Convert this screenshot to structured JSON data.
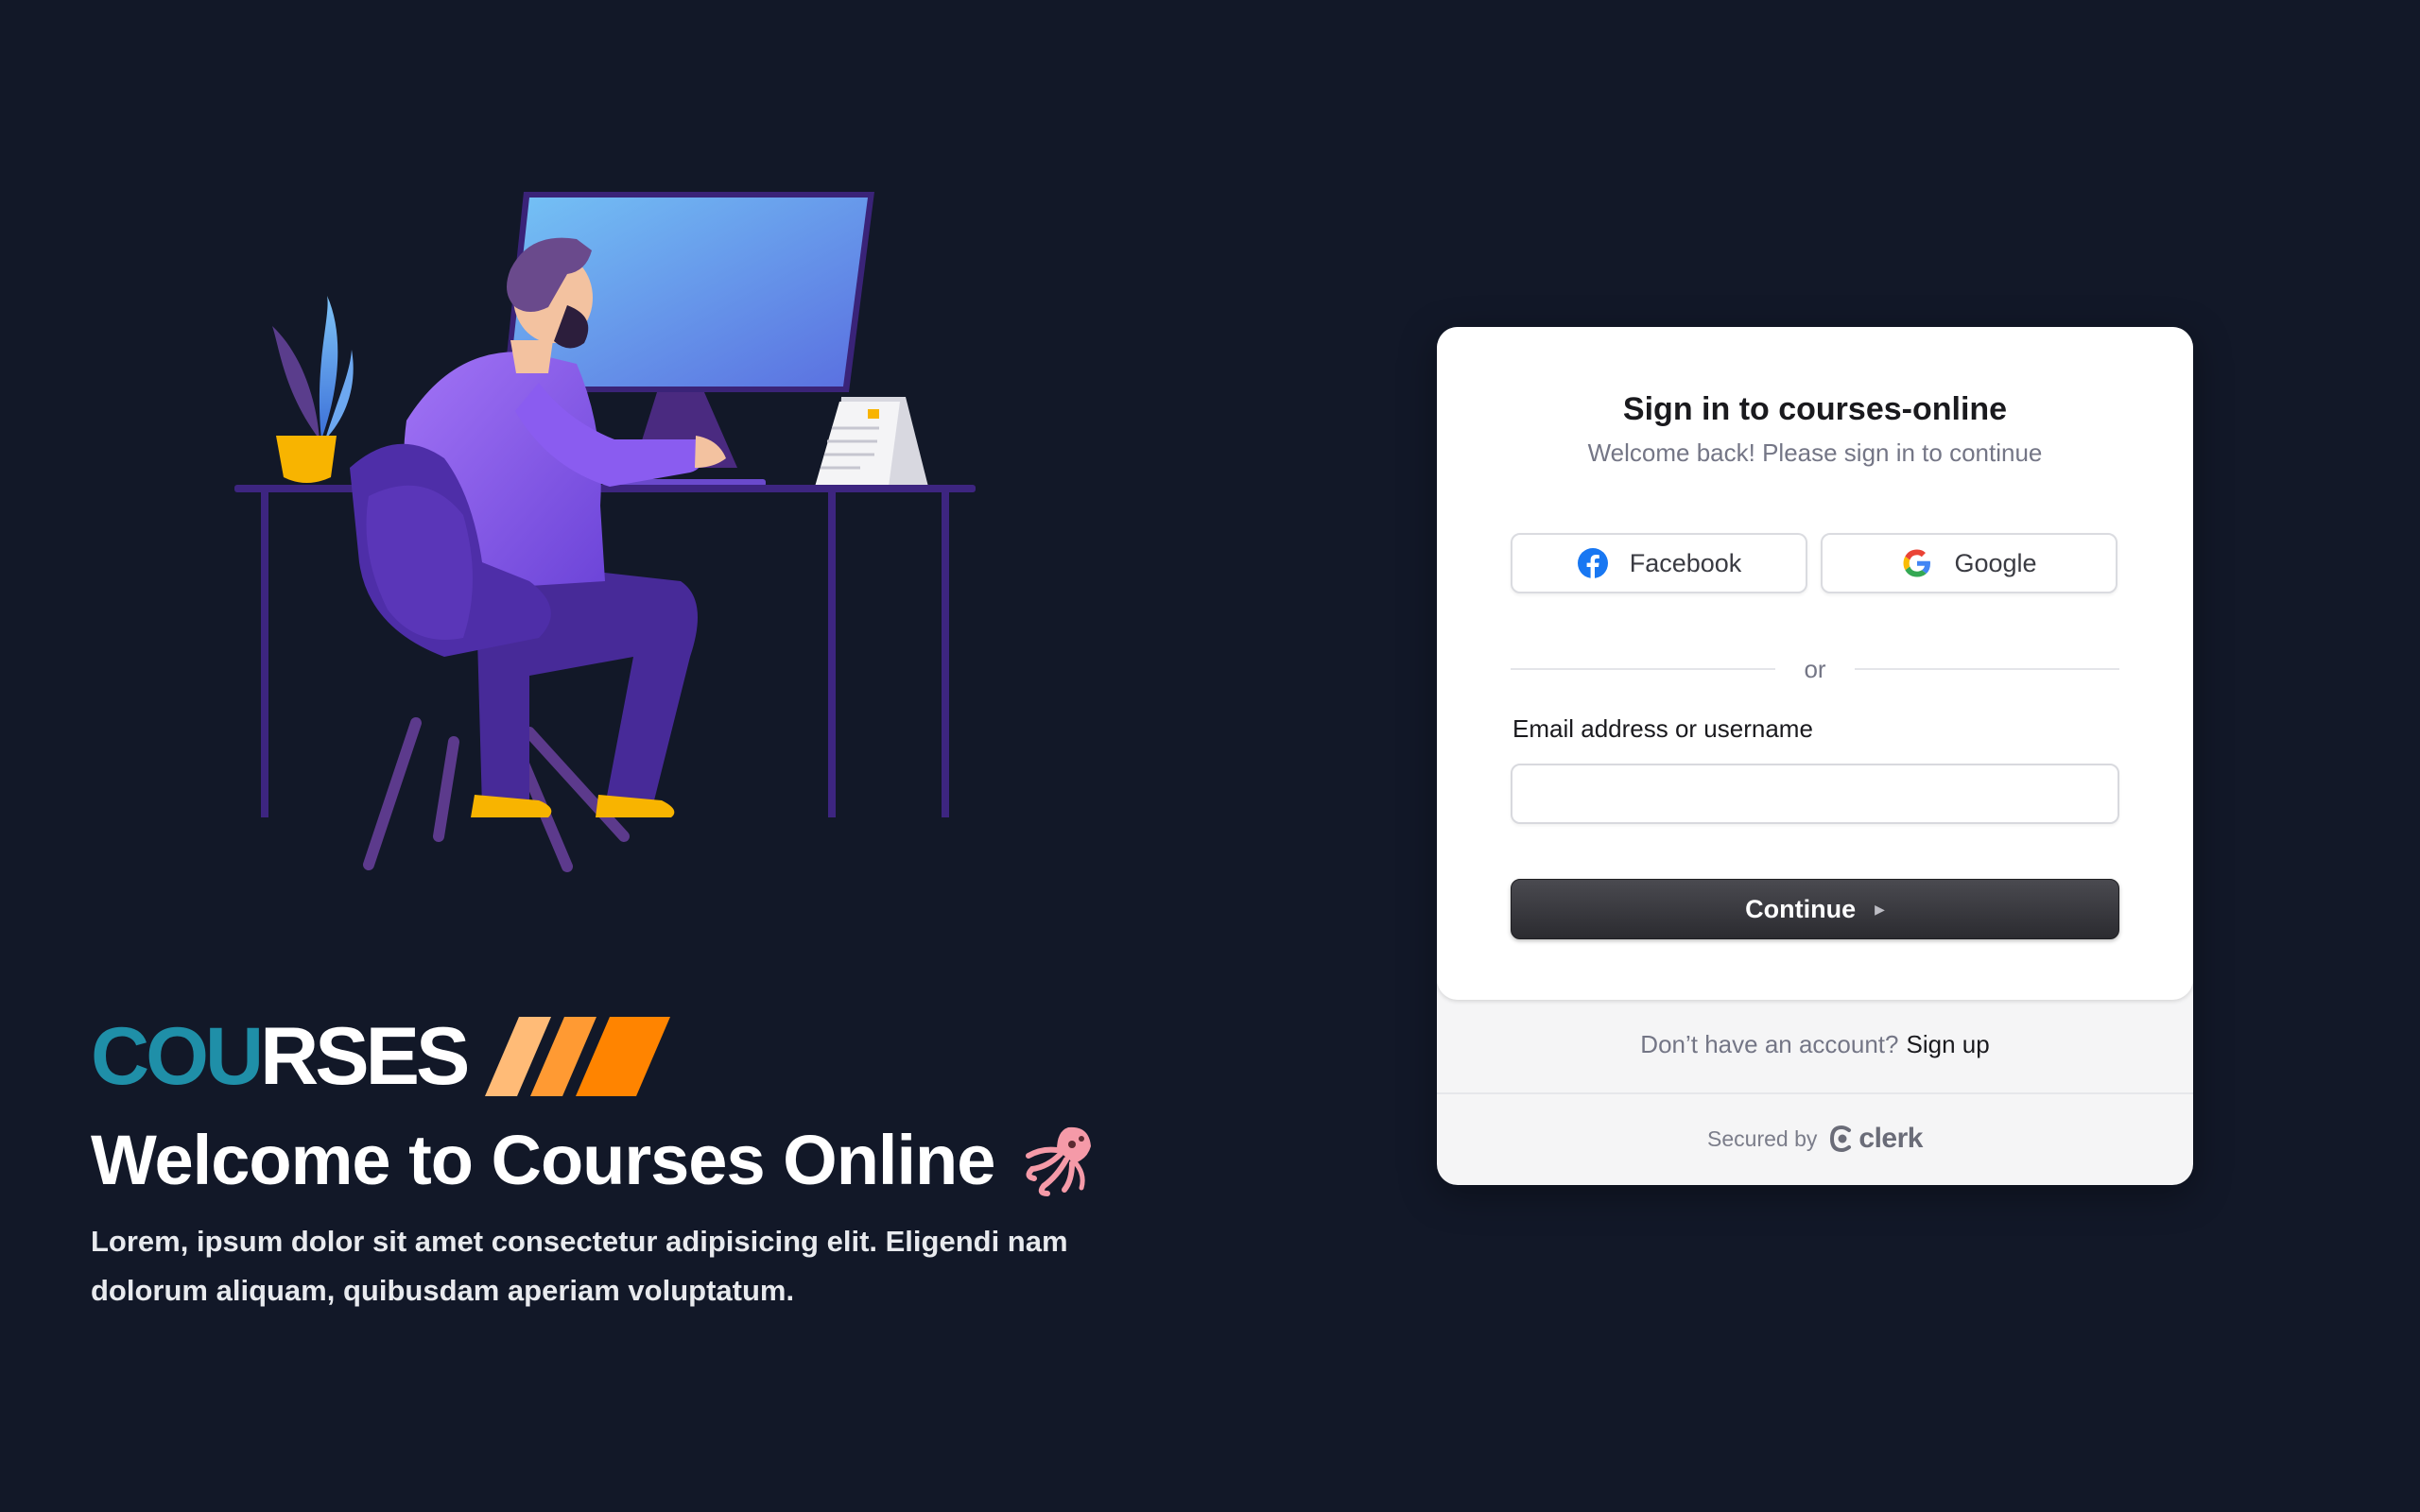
{
  "brand": {
    "logo_part1": "COU",
    "logo_part2": "RSES"
  },
  "hero": {
    "title": "Welcome to Courses Online",
    "emoji_icon": "squid-emoji",
    "body": "Lorem, ipsum dolor sit amet consectetur adipisicing elit. Eligendi nam dolorum aliquam, quibusdam aperiam voluptatum."
  },
  "signin": {
    "title": "Sign in to courses-online",
    "subtitle": "Welcome back! Please sign in to continue",
    "facebook_label": "Facebook",
    "google_label": "Google",
    "divider_text": "or",
    "email_label": "Email address or username",
    "email_value": "",
    "continue_label": "Continue",
    "no_account_text": "Don’t have an account?",
    "signup_link": "Sign up",
    "secured_by": "Secured by",
    "secured_brand": "clerk"
  },
  "colors": {
    "background": "#121828",
    "logo_accent": "#1f8fa8",
    "stripes": "#ff8a1a",
    "button_dark": "#2b2b30"
  }
}
